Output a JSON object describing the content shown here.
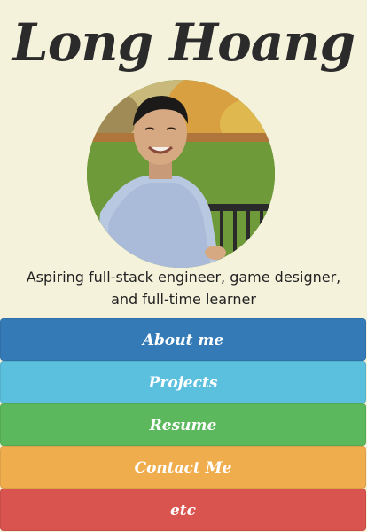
{
  "header": {
    "name": "Long Hoang"
  },
  "profile": {
    "avatar_alt": "profile-photo",
    "tagline": "Aspiring full-stack engineer, game designer, and full-time learner"
  },
  "nav": {
    "items": [
      {
        "label": "About me",
        "color": "#337ab7"
      },
      {
        "label": "Projects",
        "color": "#5bc0de"
      },
      {
        "label": "Resume",
        "color": "#5cb85c"
      },
      {
        "label": "Contact Me",
        "color": "#f0ad4e"
      },
      {
        "label": "etc",
        "color": "#d9534f"
      }
    ]
  },
  "colors": {
    "background": "#f5f2dc",
    "text": "#222222"
  }
}
